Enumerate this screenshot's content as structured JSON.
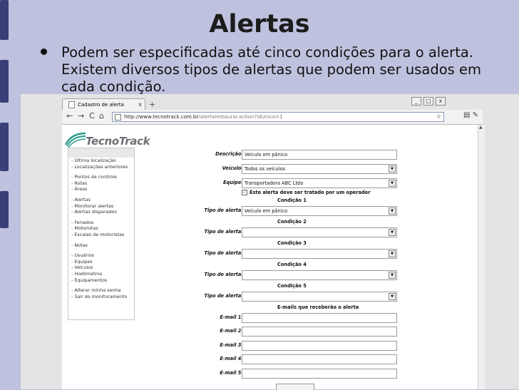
{
  "slide": {
    "title": "Alertas",
    "bullet_text": "Podem ser especificadas até cinco condições para o alerta. Existem diversos tipos de alertas que podem ser usados em cada condição."
  },
  "browser": {
    "tab_title": "Cadastro de alerta",
    "tab_close": "x",
    "new_tab": "+",
    "url_host": "http://www.tecnotrack.com.br",
    "url_path": "/alertarestaurar.action?idUnico=1",
    "back": "←",
    "forward": "→",
    "reload": "C",
    "home": "⌂",
    "star": "☆",
    "page_icon": "▤",
    "tools_icon": "✎",
    "window_controls": [
      "_",
      "□",
      "x"
    ]
  },
  "logo_text": "TecnoTrack",
  "sidebar": {
    "groups": [
      [
        "- Última localização",
        "- Localizações anteriores"
      ],
      [
        "- Pontos de controle",
        "- Rotas",
        "- Áreas"
      ],
      [
        "- Alertas",
        "- Monitorar alertas",
        "- Alertas disparados"
      ],
      [
        "- Feriados",
        "- Motoristas",
        "- Escalas de motoristas"
      ],
      [
        "- Notas"
      ],
      [
        "- Usuários",
        "- Equipes",
        "- Veículos",
        "- Hodômetros",
        "- Equipamentos"
      ],
      [
        "- Alterar minha senha",
        "- Sair do monitoramento"
      ]
    ]
  },
  "form": {
    "descricao_label": "Descrição:",
    "descricao_value": "Veículo em pânico",
    "veiculo_label": "Veículo:",
    "veiculo_value": "Todos os veículos",
    "equipe_label": "Equipe:",
    "equipe_value": "Transportadora ABC Ltda",
    "operador_check": "Este alerta deve ser tratado por um operador",
    "conditions": [
      {
        "title": "Condição 1",
        "label": "Tipo de alerta:",
        "value": "Veículo em pânico"
      },
      {
        "title": "Condição 2",
        "label": "Tipo de alerta:",
        "value": ""
      },
      {
        "title": "Condição 3",
        "label": "Tipo de alerta:",
        "value": ""
      },
      {
        "title": "Condição 4",
        "label": "Tipo de alerta:",
        "value": ""
      },
      {
        "title": "Condição 5",
        "label": "Tipo de alerta:",
        "value": ""
      }
    ],
    "emails_title": "E-mails que receberão o alerta",
    "email_labels": [
      "E-mail 1:",
      "E-mail 2:",
      "E-mail 3:",
      "E-mail 4:",
      "E-mail 5:"
    ],
    "dropdown_arrow": "▼",
    "check_mark": "✓"
  },
  "colors": {
    "slide_bg": "#bfc2de",
    "left_bar": "#3a3f7a"
  }
}
